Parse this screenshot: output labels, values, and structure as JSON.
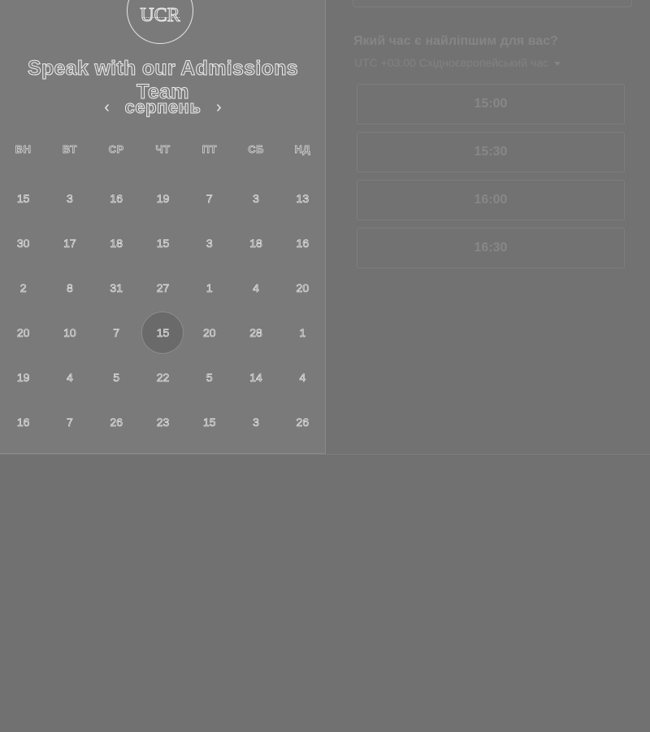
{
  "logo": {
    "text": "UCR"
  },
  "title": "Speak with our Admissions Team",
  "calendar": {
    "month": "серпень",
    "prev_icon": "chevron-left-icon",
    "next_icon": "chevron-right-icon",
    "weekdays": [
      "ВН",
      "ВТ",
      "СР",
      "ЧТ",
      "ПТ",
      "СБ",
      "НД"
    ],
    "weeks": [
      [
        "15",
        "3",
        "16",
        "19",
        "7",
        "3",
        "13"
      ],
      [
        "30",
        "17",
        "18",
        "15",
        "3",
        "18",
        "16"
      ],
      [
        "2",
        "8",
        "31",
        "27",
        "1",
        "4",
        "20"
      ],
      [
        "20",
        "10",
        "7",
        "15",
        "20",
        "28",
        "1"
      ],
      [
        "19",
        "4",
        "5",
        "22",
        "5",
        "14",
        "4"
      ],
      [
        "16",
        "7",
        "26",
        "23",
        "15",
        "3",
        "26"
      ]
    ],
    "selected": {
      "week": 3,
      "day": 3
    }
  },
  "times": {
    "question": "Який час є найліпшим для вас?",
    "timezone": "UTC +03:00 Східноєвропейський час",
    "slots": [
      "15:00",
      "15:30",
      "16:00",
      "16:30"
    ]
  },
  "colors": {
    "background": "#717171",
    "panel": "#7a7a7a",
    "outline_text": "#efefef"
  }
}
